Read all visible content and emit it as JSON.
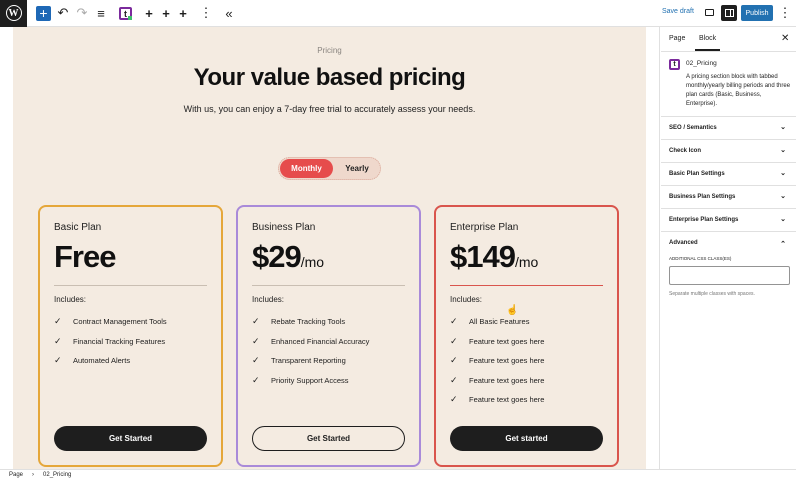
{
  "toolbar": {
    "logo": "W",
    "add_icon": "+",
    "undo_icon": "↶",
    "redo_icon": "↷",
    "list_view_icon": "≡",
    "block_icon_letter": "t",
    "plus1": "+",
    "plus2": "+",
    "plus3": "+",
    "more_icon": "⋮",
    "collapse_icon": "«",
    "save_draft": "Save draft",
    "publish": "Publish",
    "options_icon": "⋮"
  },
  "canvas": {
    "eyebrow": "Pricing",
    "headline": "Your value based pricing",
    "subline": "With us, you can enjoy a 7-day free trial to accurately assess your needs.",
    "toggle": {
      "monthly": "Monthly",
      "yearly": "Yearly"
    }
  },
  "plans": [
    {
      "name": "Basic Plan",
      "price": "Free",
      "period": "",
      "includes": "Includes:",
      "features": [
        "Contract Management Tools",
        "Financial Tracking Features",
        "Automated Alerts"
      ],
      "cta": "Get Started",
      "color": "#e5a73a"
    },
    {
      "name": "Business Plan",
      "price": "$29",
      "period": "/mo",
      "includes": "Includes:",
      "features": [
        "Rebate Tracking Tools",
        "Enhanced Financial Accuracy",
        "Transparent Reporting",
        "Priority Support Access"
      ],
      "cta": "Get Started",
      "color": "#a98ad9"
    },
    {
      "name": "Enterprise Plan",
      "price": "$149",
      "period": "/mo",
      "includes": "Includes:",
      "features": [
        "All Basic Features",
        "Feature text goes here",
        "Feature text goes here",
        "Feature text goes here",
        "Feature text goes here"
      ],
      "cta": "Get started",
      "color": "#d9554d"
    }
  ],
  "panel": {
    "tabs": [
      "Page",
      "Block"
    ],
    "close_icon": "✕",
    "block": {
      "icon_letter": "t",
      "title": "02_Pricing",
      "description": "A pricing section block with tabbed monthly/yearly billing periods and three plan cards (Basic, Business, Enterprise)."
    },
    "sections": [
      "SEO / Semantics",
      "Check Icon",
      "Basic Plan Settings",
      "Business Plan Settings",
      "Enterprise Plan Settings",
      "Advanced"
    ],
    "advanced": {
      "label": "ADDITIONAL CSS CLASS(ES)",
      "value": "",
      "help": "Separate multiple classes with spaces."
    }
  },
  "footer": {
    "crumb1": "Page",
    "separator": "›",
    "crumb2": "02_Pricing"
  },
  "colors": {
    "canvas_bg": "#f4ebe1",
    "accent": "#2271b1",
    "toggle_active": "#e64c4c"
  }
}
